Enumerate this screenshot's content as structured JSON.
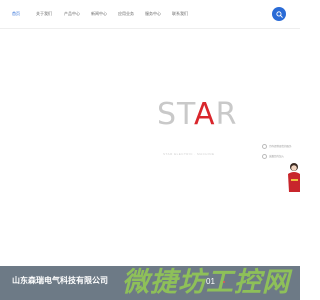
{
  "nav": {
    "items": [
      {
        "label": "首页",
        "active": true
      },
      {
        "label": "关于我们"
      },
      {
        "label": "产品中心"
      },
      {
        "label": "新闻中心"
      },
      {
        "label": "应用业务"
      },
      {
        "label": "服务中心"
      },
      {
        "label": "联系我们"
      }
    ],
    "search_icon": "search-icon",
    "accent_color": "#2a6bd6"
  },
  "hero": {
    "logo_prefix": "ST",
    "logo_accent": "A",
    "logo_suffix": "R",
    "logo_accent_color": "#d9262c",
    "tagline": "STAR ELECTRIC · MACHINE",
    "side_info": [
      {
        "text": "为你提供更优的服务"
      },
      {
        "text": "诚邀您的加入"
      }
    ]
  },
  "banner": {
    "company": "山东森瑞电气科技有限公司",
    "page_num": "01",
    "watermark": "微捷坊工控网",
    "background": "#6d7a86"
  }
}
